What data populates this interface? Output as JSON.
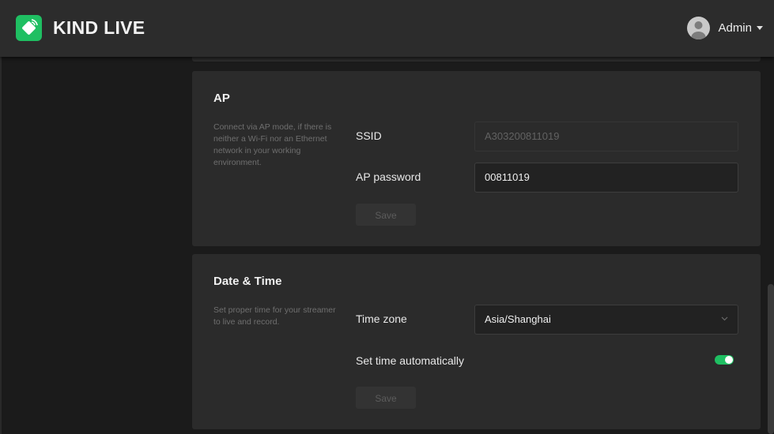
{
  "app": {
    "brand": "KIND LIVE"
  },
  "header": {
    "user_name": "Admin"
  },
  "ap": {
    "title": "AP",
    "description": "Connect via AP mode, if there is neither a Wi-Fi nor an Ethernet network in your working environment.",
    "ssid_label": "SSID",
    "ssid_value": "A303200811019",
    "password_label": "AP password",
    "password_value": "00811019",
    "save_label": "Save"
  },
  "datetime": {
    "title": "Date & Time",
    "description": "Set proper time for your streamer to live and record.",
    "timezone_label": "Time zone",
    "timezone_value": "Asia/Shanghai",
    "auto_label": "Set time automatically",
    "auto_enabled": true,
    "save_label": "Save"
  },
  "colors": {
    "accent": "#1fbf62",
    "background": "#1b1b1b",
    "card": "#2b2b2b",
    "topbar": "#2c2c2c"
  }
}
